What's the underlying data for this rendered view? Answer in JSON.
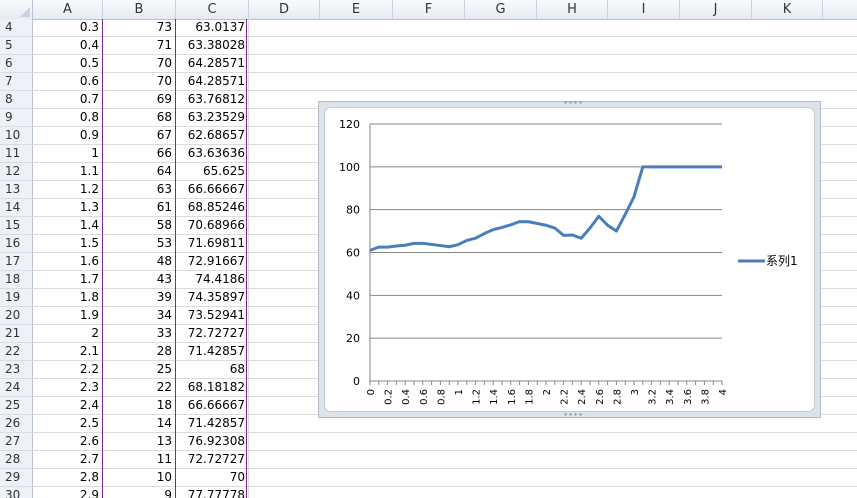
{
  "columns": [
    "A",
    "B",
    "C",
    "D",
    "E",
    "F",
    "G",
    "H",
    "I",
    "J",
    "K"
  ],
  "rows": [
    {
      "n": "4",
      "a": "0.3",
      "b": "73",
      "c": "63.0137"
    },
    {
      "n": "5",
      "a": "0.4",
      "b": "71",
      "c": "63.38028"
    },
    {
      "n": "6",
      "a": "0.5",
      "b": "70",
      "c": "64.28571"
    },
    {
      "n": "7",
      "a": "0.6",
      "b": "70",
      "c": "64.28571"
    },
    {
      "n": "8",
      "a": "0.7",
      "b": "69",
      "c": "63.76812"
    },
    {
      "n": "9",
      "a": "0.8",
      "b": "68",
      "c": "63.23529"
    },
    {
      "n": "10",
      "a": "0.9",
      "b": "67",
      "c": "62.68657"
    },
    {
      "n": "11",
      "a": "1",
      "b": "66",
      "c": "63.63636"
    },
    {
      "n": "12",
      "a": "1.1",
      "b": "64",
      "c": "65.625"
    },
    {
      "n": "13",
      "a": "1.2",
      "b": "63",
      "c": "66.66667"
    },
    {
      "n": "14",
      "a": "1.3",
      "b": "61",
      "c": "68.85246"
    },
    {
      "n": "15",
      "a": "1.4",
      "b": "58",
      "c": "70.68966"
    },
    {
      "n": "16",
      "a": "1.5",
      "b": "53",
      "c": "71.69811"
    },
    {
      "n": "17",
      "a": "1.6",
      "b": "48",
      "c": "72.91667"
    },
    {
      "n": "18",
      "a": "1.7",
      "b": "43",
      "c": "74.4186"
    },
    {
      "n": "19",
      "a": "1.8",
      "b": "39",
      "c": "74.35897"
    },
    {
      "n": "20",
      "a": "1.9",
      "b": "34",
      "c": "73.52941"
    },
    {
      "n": "21",
      "a": "2",
      "b": "33",
      "c": "72.72727"
    },
    {
      "n": "22",
      "a": "2.1",
      "b": "28",
      "c": "71.42857"
    },
    {
      "n": "23",
      "a": "2.2",
      "b": "25",
      "c": "68"
    },
    {
      "n": "24",
      "a": "2.3",
      "b": "22",
      "c": "68.18182"
    },
    {
      "n": "25",
      "a": "2.4",
      "b": "18",
      "c": "66.66667"
    },
    {
      "n": "26",
      "a": "2.5",
      "b": "14",
      "c": "71.42857"
    },
    {
      "n": "27",
      "a": "2.6",
      "b": "13",
      "c": "76.92308"
    },
    {
      "n": "28",
      "a": "2.7",
      "b": "11",
      "c": "72.72727"
    },
    {
      "n": "29",
      "a": "2.8",
      "b": "10",
      "c": "70"
    },
    {
      "n": "30",
      "a": "2.9",
      "b": "9",
      "c": "77.77778"
    }
  ],
  "chart_data": {
    "type": "line",
    "title": "",
    "xlabel": "",
    "ylabel": "",
    "ylim": [
      0,
      120
    ],
    "yticks": [
      "0",
      "20",
      "40",
      "60",
      "80",
      "100",
      "120"
    ],
    "grid": true,
    "legend": "right",
    "color": "#4a7ebb",
    "x": [
      "0",
      "0.1",
      "0.2",
      "0.3",
      "0.4",
      "0.5",
      "0.6",
      "0.7",
      "0.8",
      "0.9",
      "1",
      "1.1",
      "1.2",
      "1.3",
      "1.4",
      "1.5",
      "1.6",
      "1.7",
      "1.8",
      "1.9",
      "2",
      "2.1",
      "2.2",
      "2.3",
      "2.4",
      "2.5",
      "2.6",
      "2.7",
      "2.8",
      "2.9",
      "3",
      "3.1",
      "3.2",
      "3.3",
      "3.4",
      "3.5",
      "3.6",
      "3.7",
      "3.8",
      "3.9",
      "4"
    ],
    "xtick_labels": [
      "0",
      "0.2",
      "0.4",
      "0.6",
      "0.8",
      "1",
      "1.2",
      "1.4",
      "1.6",
      "1.8",
      "2",
      "2.2",
      "2.4",
      "2.6",
      "2.8",
      "3",
      "3.2",
      "3.4",
      "3.6",
      "3.8",
      "4"
    ],
    "series": [
      {
        "name": "系列1",
        "values": [
          61,
          62.5,
          62.5,
          63.0137,
          63.38028,
          64.28571,
          64.28571,
          63.76812,
          63.23529,
          62.68657,
          63.63636,
          65.625,
          66.66667,
          68.85246,
          70.68966,
          71.69811,
          72.91667,
          74.4186,
          74.35897,
          73.52941,
          72.72727,
          71.42857,
          68,
          68.18182,
          66.66667,
          71.42857,
          76.92308,
          72.72727,
          70,
          77.77778,
          86,
          100,
          100,
          100,
          100,
          100,
          100,
          100,
          100,
          100,
          100
        ]
      }
    ]
  }
}
